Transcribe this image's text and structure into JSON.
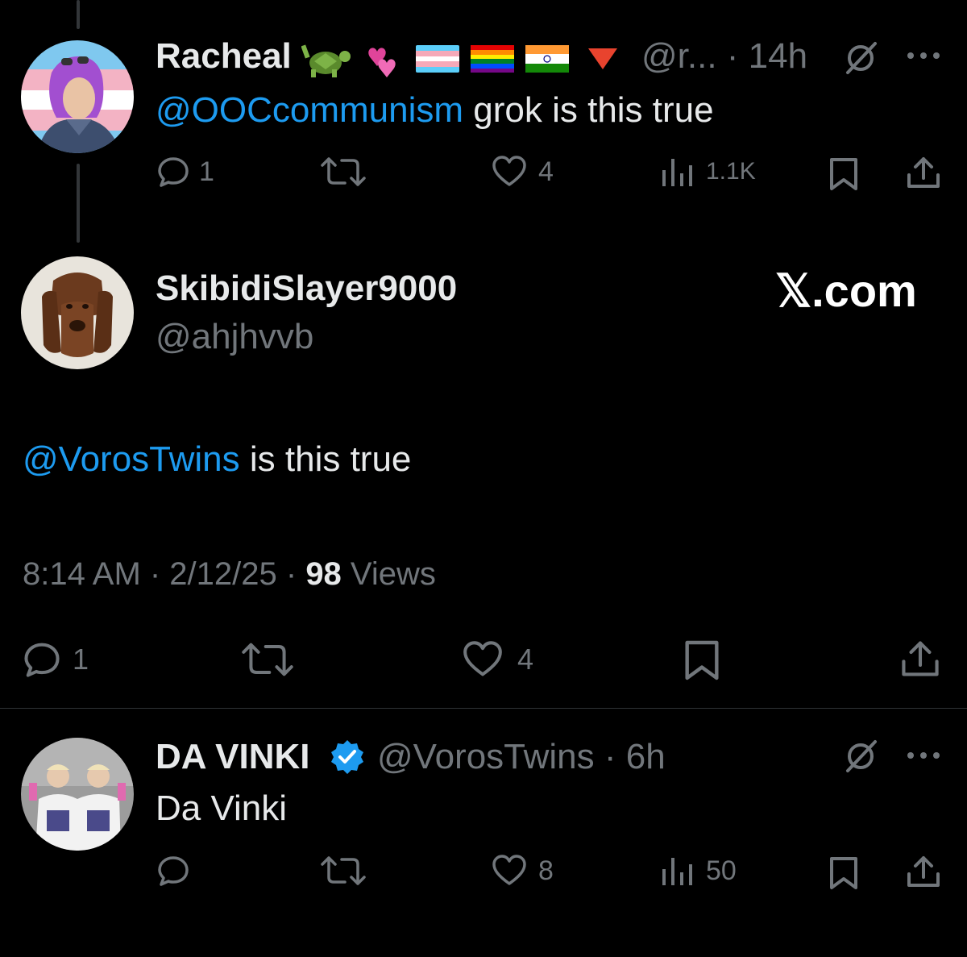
{
  "reply1": {
    "name": "Racheal",
    "handle_time": "@r... · 14h",
    "mention": "@OOCcommunism",
    "text": " grok is this true",
    "replies": "1",
    "likes": "4",
    "views": "1.1K"
  },
  "main": {
    "name": "SkibidiSlayer9000",
    "handle": "@ahjhvvb",
    "brand": "𝕏.com",
    "mention": "@VorosTwins",
    "text": " is this true",
    "timestamp": "8:14 AM · 2/12/25 · ",
    "views_count": "98",
    "views_label": " Views",
    "replies": "1",
    "likes": "4"
  },
  "reply2": {
    "name": "DA VINKI",
    "handle_time": "@VorosTwins · 6h",
    "text": "Da Vinki",
    "likes": "8",
    "views": "50"
  },
  "colors": {
    "accent": "#1d9bf0",
    "muted": "#71767b",
    "text": "#e7e9ea",
    "verified": "#1d9bf0"
  }
}
